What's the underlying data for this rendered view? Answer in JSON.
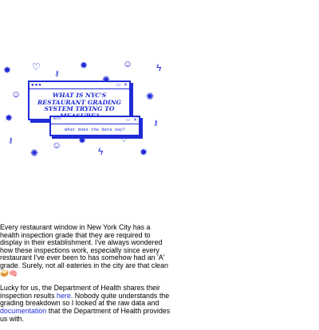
{
  "hero": {
    "title": "WHAT IS NYC'S RESTAURANT GRADING SYSTEM TRYING TO MEASURE?",
    "subtitle_window_label": "NOTE",
    "subtitle": "What does the data say?",
    "accent_color": "#1f2bd6",
    "doodle_icons": [
      "star-icon",
      "heart-icon",
      "key-icon",
      "star-icon",
      "face-icon",
      "lightning-icon",
      "face-icon",
      "bug-icon",
      "bug-icon",
      "key-icon",
      "star-icon",
      "bug-icon",
      "face-icon",
      "heart-icon",
      "lightning-icon",
      "star-icon",
      "key-icon",
      "bug-icon"
    ]
  },
  "article": {
    "paragraph1": "Every restaurant window in New York City has a health inspection grade that they are required to display in their establishment. I've always wondered how these inspections work, especially since every restaurant I've ever been to has somehow had an 'A' grade. Surely, not all eateries in the city are that clean 🥪🧠",
    "p2_part1": "Lucky for us, the Department of Health shares their inspection results ",
    "link_here": "here",
    "p2_part2": ". Nobody quite understands the grading breakdown so I looked at the raw data and ",
    "link_documentation": "documentation",
    "p2_part3": " that the Department of Health provides us with."
  }
}
